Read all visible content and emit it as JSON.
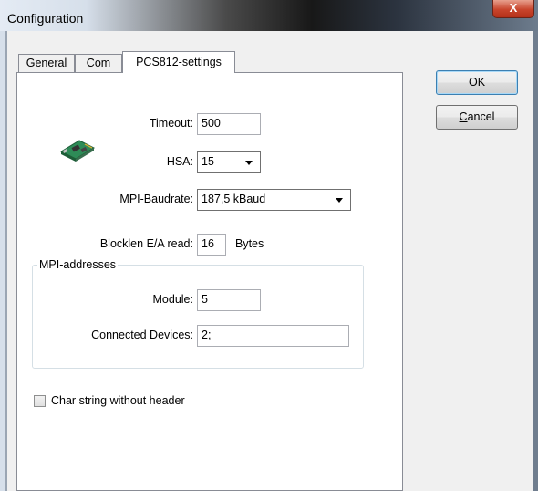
{
  "window": {
    "title": "Configuration",
    "close_glyph": "X"
  },
  "tabs": [
    {
      "label": "General",
      "active": false
    },
    {
      "label": "Com",
      "active": false
    },
    {
      "label": "PCS812-settings",
      "active": true
    }
  ],
  "form": {
    "timeout": {
      "label": "Timeout:",
      "value": "500"
    },
    "hsa": {
      "label": "HSA:",
      "value": "15"
    },
    "mpi_baudrate": {
      "label": "MPI-Baudrate:",
      "value": "187,5 kBaud"
    },
    "blocklen": {
      "label": "Blocklen E/A read:",
      "value": "16",
      "unit": "Bytes"
    },
    "mpi_addresses": {
      "title": "MPI-addresses",
      "module": {
        "label": "Module:",
        "value": "5"
      },
      "connected_devices": {
        "label": "Connected Devices:",
        "value": "2;"
      }
    },
    "char_string": {
      "label": "Char string without header",
      "checked": false
    }
  },
  "buttons": {
    "ok": "OK",
    "cancel_first": "C",
    "cancel_rest": "ancel"
  },
  "icons": {
    "device": "pcb-card-icon"
  }
}
